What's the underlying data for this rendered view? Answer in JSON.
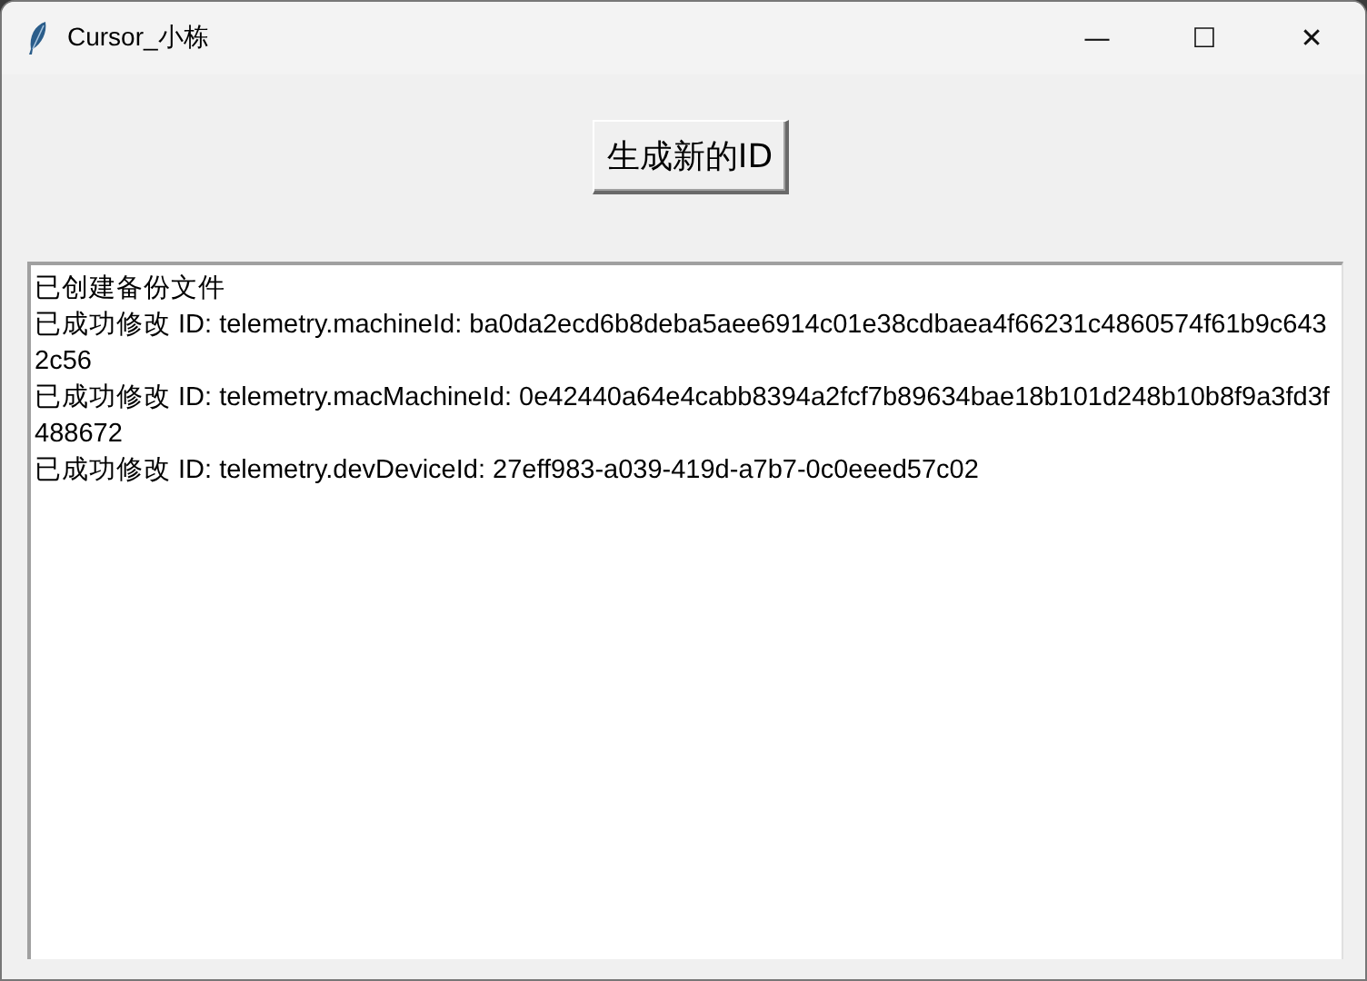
{
  "window": {
    "title": "Cursor_小栋",
    "controls": [
      "—",
      "☐",
      "✕"
    ]
  },
  "button": {
    "label": "生成新的ID"
  },
  "log": [
    "已创建备份文件",
    "已成功修改 ID: telemetry.machineId: ba0da2ecd6b8deba5aee6914c01e38cdbaea4f66231c4860574f61b9c6432c56",
    "已成功修改 ID: telemetry.macMachineId: 0e42440a64e4cabb8394a2fcf7b89634bae18b101d248b10b8f9a3fd3f488672",
    "已成功修改 ID: telemetry.devDeviceId: 27eff983-a039-419d-a7b7-0c0eeed57c02"
  ]
}
